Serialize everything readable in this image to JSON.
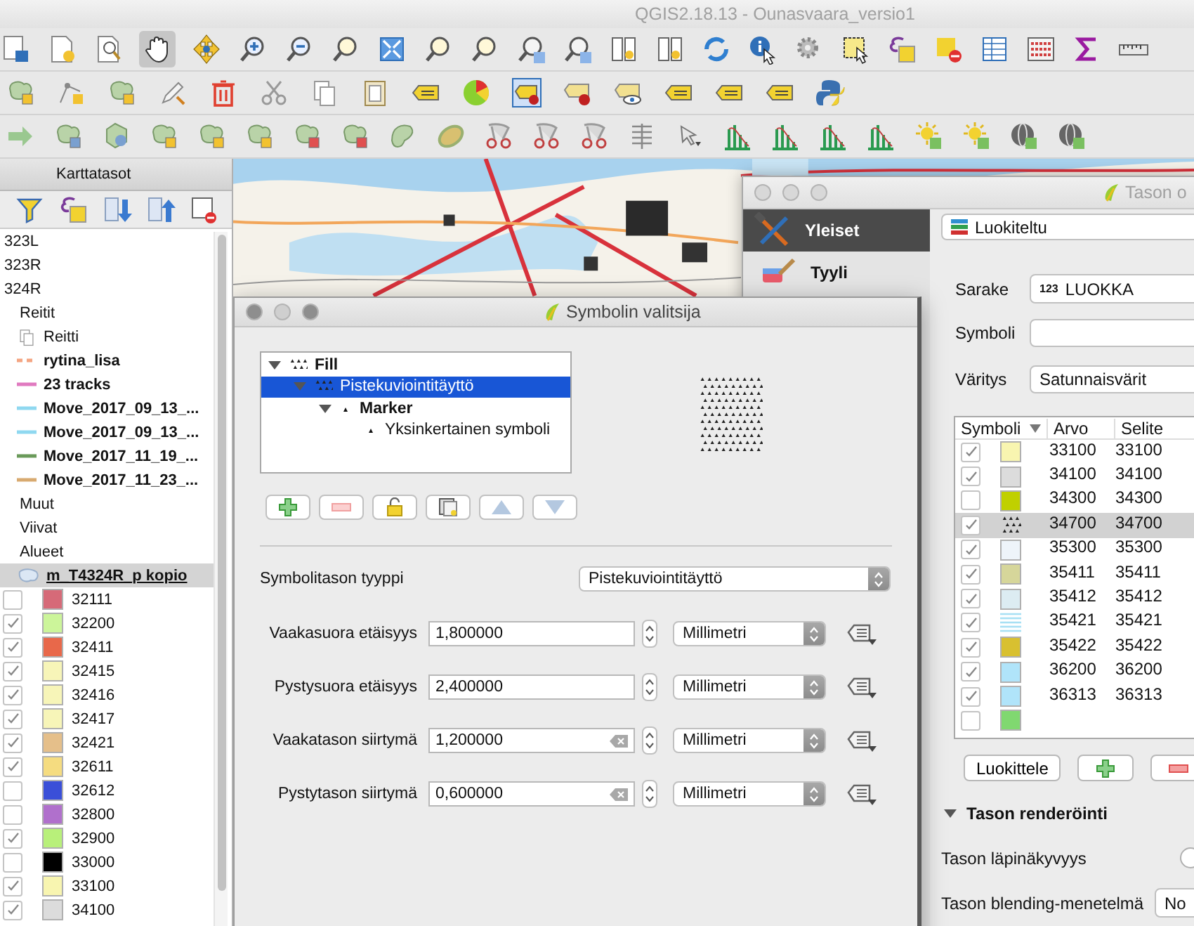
{
  "window": {
    "title": "QGIS2.18.13 - Ounasvaara_versio1"
  },
  "toolbar": {
    "pan_tool_selected": true
  },
  "layers_panel": {
    "title": "Karttatasot",
    "items": [
      {
        "kind": "layer",
        "label": "323L",
        "selected": false
      },
      {
        "kind": "layer",
        "label": "323R",
        "selected": false
      },
      {
        "kind": "layer",
        "label": "324R",
        "selected": false
      },
      {
        "kind": "group",
        "label": "Reitit",
        "selected": false
      },
      {
        "kind": "route",
        "label": "Reitti",
        "selected": false
      },
      {
        "kind": "line",
        "label": "rytina_lisa",
        "color": "#f4a582",
        "dashed": true,
        "selected": false
      },
      {
        "kind": "line",
        "label": "23 tracks",
        "color": "#e07ac0",
        "dashed": false,
        "selected": false
      },
      {
        "kind": "line",
        "label": "Move_2017_09_13_...",
        "color": "#8fd8f0",
        "dashed": false,
        "selected": false
      },
      {
        "kind": "line",
        "label": "Move_2017_09_13_...",
        "color": "#8fd8f0",
        "dashed": false,
        "selected": false
      },
      {
        "kind": "line",
        "label": "Move_2017_11_19_...",
        "color": "#6a9a5a",
        "dashed": false,
        "selected": false
      },
      {
        "kind": "line",
        "label": "Move_2017_11_23_...",
        "color": "#d8aa70",
        "dashed": false,
        "selected": false
      },
      {
        "kind": "group",
        "label": "Muut",
        "selected": false
      },
      {
        "kind": "group",
        "label": "Viivat",
        "selected": false
      },
      {
        "kind": "group",
        "label": "Alueet",
        "selected": false
      },
      {
        "kind": "polygon_layer",
        "label": "m_T4324R_p kopio",
        "selected": true,
        "children": [
          {
            "label": "32111",
            "checked": false,
            "color": "#d66a78"
          },
          {
            "label": "32200",
            "checked": true,
            "color": "#ccf59a"
          },
          {
            "label": "32411",
            "checked": true,
            "color": "#e8684a"
          },
          {
            "label": "32415",
            "checked": true,
            "color": "#f7f5b8"
          },
          {
            "label": "32416",
            "checked": true,
            "color": "#f7f5b8"
          },
          {
            "label": "32417",
            "checked": true,
            "color": "#f7f5b8"
          },
          {
            "label": "32421",
            "checked": true,
            "color": "#e5bf8a"
          },
          {
            "label": "32611",
            "checked": true,
            "color": "#f5dc80"
          },
          {
            "label": "32612",
            "checked": false,
            "color": "#3a4fd8"
          },
          {
            "label": "32800",
            "checked": false,
            "color": "#b070cc"
          },
          {
            "label": "32900",
            "checked": true,
            "color": "#b8f07a"
          },
          {
            "label": "33000",
            "checked": false,
            "color": "#000000"
          },
          {
            "label": "33100",
            "checked": true,
            "color": "#f8f5b0"
          },
          {
            "label": "34100",
            "checked": true,
            "color": "#dcdcdc"
          }
        ]
      }
    ]
  },
  "properties_window": {
    "title": "Tason o",
    "sidebar": [
      {
        "label": "Yleiset",
        "selected": true
      },
      {
        "label": "Tyyli",
        "selected": false
      }
    ],
    "renderer": "Luokiteltu",
    "column": {
      "label": "Sarake",
      "type_badge": "123",
      "value": "LUOKKA"
    },
    "symbol": {
      "label": "Symboli"
    },
    "color_ramp": {
      "label": "Väritys",
      "value": "Satunnaisvärit"
    },
    "table": {
      "columns": [
        "Symboli",
        "Arvo",
        "Selite"
      ],
      "rows": [
        {
          "checked": true,
          "kind": "fill",
          "color": "#f8f5b0",
          "value": "33100",
          "legend": "33100",
          "selected": false
        },
        {
          "checked": true,
          "kind": "fill",
          "color": "#dcdcdc",
          "value": "34100",
          "legend": "34100",
          "selected": false
        },
        {
          "checked": false,
          "kind": "fill",
          "color": "#c0d000",
          "value": "34300",
          "legend": "34300",
          "selected": false
        },
        {
          "checked": true,
          "kind": "pattern",
          "value": "34700",
          "legend": "34700",
          "selected": true
        },
        {
          "checked": true,
          "kind": "fill",
          "color": "#eef4fa",
          "value": "35300",
          "legend": "35300",
          "selected": false
        },
        {
          "checked": true,
          "kind": "fill",
          "color": "#d6d69a",
          "value": "35411",
          "legend": "35411",
          "selected": false
        },
        {
          "checked": true,
          "kind": "fill",
          "color": "#dcecf2",
          "value": "35412",
          "legend": "35412",
          "selected": false
        },
        {
          "checked": true,
          "kind": "hatch",
          "color": "#a8e0f4",
          "value": "35421",
          "legend": "35421",
          "selected": false
        },
        {
          "checked": true,
          "kind": "fill",
          "color": "#d8c030",
          "value": "35422",
          "legend": "35422",
          "selected": false
        },
        {
          "checked": true,
          "kind": "fill",
          "color": "#b0e4fa",
          "value": "36200",
          "legend": "36200",
          "selected": false
        },
        {
          "checked": true,
          "kind": "fill",
          "color": "#b0e4fa",
          "value": "36313",
          "legend": "36313",
          "selected": false
        },
        {
          "checked": false,
          "kind": "fill",
          "color": "#80d870",
          "selected": false
        }
      ]
    },
    "classify_button": "Luokittele",
    "rendering": {
      "title": "Tason renderöinti",
      "expanded": true,
      "opacity_label": "Tason läpinäkyvyys",
      "opacity": {
        "level": 0
      },
      "blending_label": "Tason blending-menetelmä",
      "blending_value": "No"
    }
  },
  "symbol_dialog": {
    "title": "Symbolin valitsija",
    "tree": [
      {
        "kind": "fill_symbol",
        "label": "Fill",
        "selected": false,
        "expanded": true,
        "children": [
          {
            "kind": "pattern_layer",
            "label": "Pistekuviointitäyttö",
            "selected": true,
            "expanded": true,
            "children": [
              {
                "kind": "marker_symbol",
                "label": "Marker",
                "selected": false,
                "expanded": true,
                "children": [
                  {
                    "kind": "marker_layer",
                    "label": "Yksinkertainen symboli",
                    "selected": false
                  }
                ]
              }
            ]
          }
        ]
      }
    ],
    "layer_type": {
      "label": "Symbolitason tyyppi",
      "value": "Pistekuviointitäyttö"
    },
    "fields": [
      {
        "label": "Vaakasuora etäisyys",
        "value": "1,800000",
        "clearable": false,
        "unit": "Millimetri"
      },
      {
        "label": "Pystysuora etäisyys",
        "value": "2,400000",
        "clearable": false,
        "unit": "Millimetri"
      },
      {
        "label": "Vaakatason siirtymä",
        "value": "1,200000",
        "clearable": true,
        "unit": "Millimetri"
      },
      {
        "label": "Pystytason siirtymä",
        "value": "0,600000",
        "clearable": true,
        "unit": "Millimetri"
      }
    ]
  }
}
